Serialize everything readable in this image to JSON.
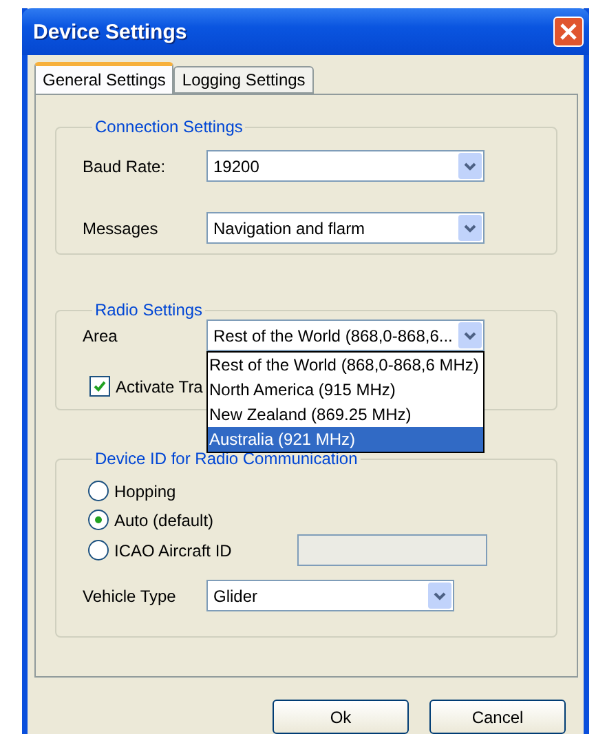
{
  "window": {
    "title": "Device Settings"
  },
  "tabs": [
    {
      "label": "General Settings",
      "selected": true
    },
    {
      "label": "Logging Settings",
      "selected": false
    }
  ],
  "connection_settings": {
    "legend": "Connection Settings",
    "fields": [
      {
        "label": "Baud Rate:",
        "value": "19200"
      },
      {
        "label": "Messages",
        "value": "Navigation and flarm"
      }
    ]
  },
  "radio_settings": {
    "legend": "Radio Settings",
    "area": {
      "label": "Area",
      "value": "Rest of the World (868,0-868,6...",
      "expanded": true,
      "options": [
        {
          "label": "Rest of the World (868,0-868,6 MHz)",
          "selected": false
        },
        {
          "label": "North America (915 MHz)",
          "selected": false
        },
        {
          "label": "New Zealand (869.25 MHz)",
          "selected": false
        },
        {
          "label": "Australia (921 MHz)",
          "selected": true
        }
      ]
    },
    "checkbox": {
      "label": "Activate Tra",
      "checked": true
    }
  },
  "device_id": {
    "legend": "Device ID for Radio Communication",
    "options": [
      {
        "label": "Hopping",
        "selected": false
      },
      {
        "label": "Auto (default)",
        "selected": true
      },
      {
        "label": "ICAO Aircraft ID",
        "selected": false
      }
    ],
    "icao_field": {
      "disabled": true
    },
    "vehicle_type": {
      "label": "Vehicle Type",
      "value": "Glider"
    }
  },
  "buttons": [
    "Ok",
    "Cancel"
  ]
}
